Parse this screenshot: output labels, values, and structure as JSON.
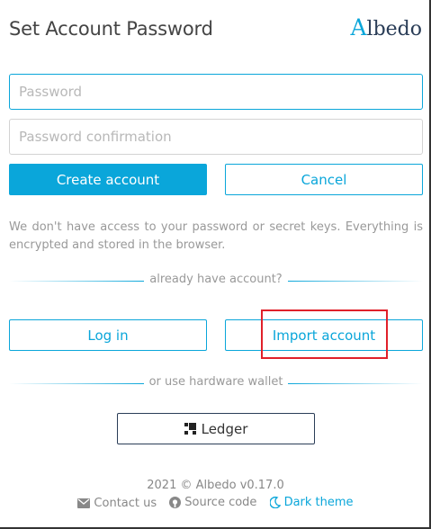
{
  "header": {
    "title": "Set Account Password",
    "logo_initial": "A",
    "logo_rest": "lbedo"
  },
  "form": {
    "password_placeholder": "Password",
    "confirm_placeholder": "Password confirmation",
    "create_label": "Create account",
    "cancel_label": "Cancel"
  },
  "info_text": "We don't have access to your password or secret keys. Everything is encrypted and stored in the browser.",
  "existing": {
    "divider": "already have account?",
    "login_label": "Log in",
    "import_label": "Import account"
  },
  "hardware": {
    "divider": "or use hardware wallet",
    "ledger_label": "Ledger"
  },
  "footer": {
    "copyright": "2021 © Albedo v0.17.0",
    "contact": "Contact us",
    "source": "Source code",
    "theme": "Dark theme"
  },
  "colors": {
    "accent": "#0aa6da",
    "highlight": "#e0202a",
    "brand_dark": "#2a3d57"
  },
  "icons": [
    "ledger-icon",
    "mail-icon",
    "github-icon",
    "moon-icon"
  ]
}
